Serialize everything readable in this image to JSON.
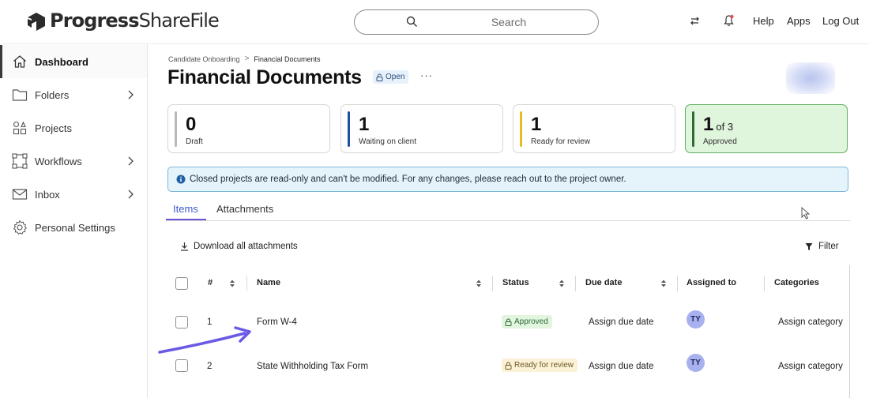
{
  "header": {
    "brand": "Progress",
    "product": "ShareFile",
    "search_placeholder": "Search",
    "help": "Help",
    "apps": "Apps",
    "logout": "Log Out"
  },
  "sidebar": {
    "items": [
      {
        "label": "Dashboard",
        "icon": "home-icon"
      },
      {
        "label": "Folders",
        "icon": "folder-icon"
      },
      {
        "label": "Projects",
        "icon": "projects-icon"
      },
      {
        "label": "Workflows",
        "icon": "workflows-icon"
      },
      {
        "label": "Inbox",
        "icon": "mail-icon"
      },
      {
        "label": "Personal Settings",
        "icon": "gear-icon"
      }
    ]
  },
  "breadcrumb": {
    "parent": "Candidate Onboarding",
    "separator": ">",
    "current": "Financial Documents"
  },
  "page": {
    "title": "Financial Documents",
    "badge": "Open",
    "more": "···"
  },
  "stats": [
    {
      "value": "0",
      "suffix": "",
      "label": "Draft",
      "color": "#b9b9b9"
    },
    {
      "value": "1",
      "suffix": "",
      "label": "Waiting on client",
      "color": "#1f4fa3"
    },
    {
      "value": "1",
      "suffix": "",
      "label": "Ready for review",
      "color": "#e4bd2c"
    },
    {
      "value": "1",
      "suffix": "of 3",
      "label": "Approved",
      "color": "#2f6b34"
    }
  ],
  "notice": "Closed projects are read-only and can't be modified. For any changes, please reach out to the project owner.",
  "tabs": [
    "Items",
    "Attachments"
  ],
  "toolbar": {
    "download": "Download all attachments",
    "filter": "Filter"
  },
  "table": {
    "headers": {
      "num": "#",
      "name": "Name",
      "status": "Status",
      "due": "Due date",
      "assigned": "Assigned to",
      "categories": "Categories"
    },
    "rows": [
      {
        "num": "1",
        "name": "Form W-4",
        "status": "Approved",
        "due": "Assign due date",
        "assignee": "TY",
        "category": "Assign category"
      },
      {
        "num": "2",
        "name": "State Withholding Tax Form",
        "status": "Ready for review",
        "due": "Assign due date",
        "assignee": "TY",
        "category": "Assign category"
      }
    ]
  },
  "colors": {
    "accent": "#6b56d9",
    "notice_bg": "#e5f3fb",
    "approved_bg": "#dff5dc"
  }
}
